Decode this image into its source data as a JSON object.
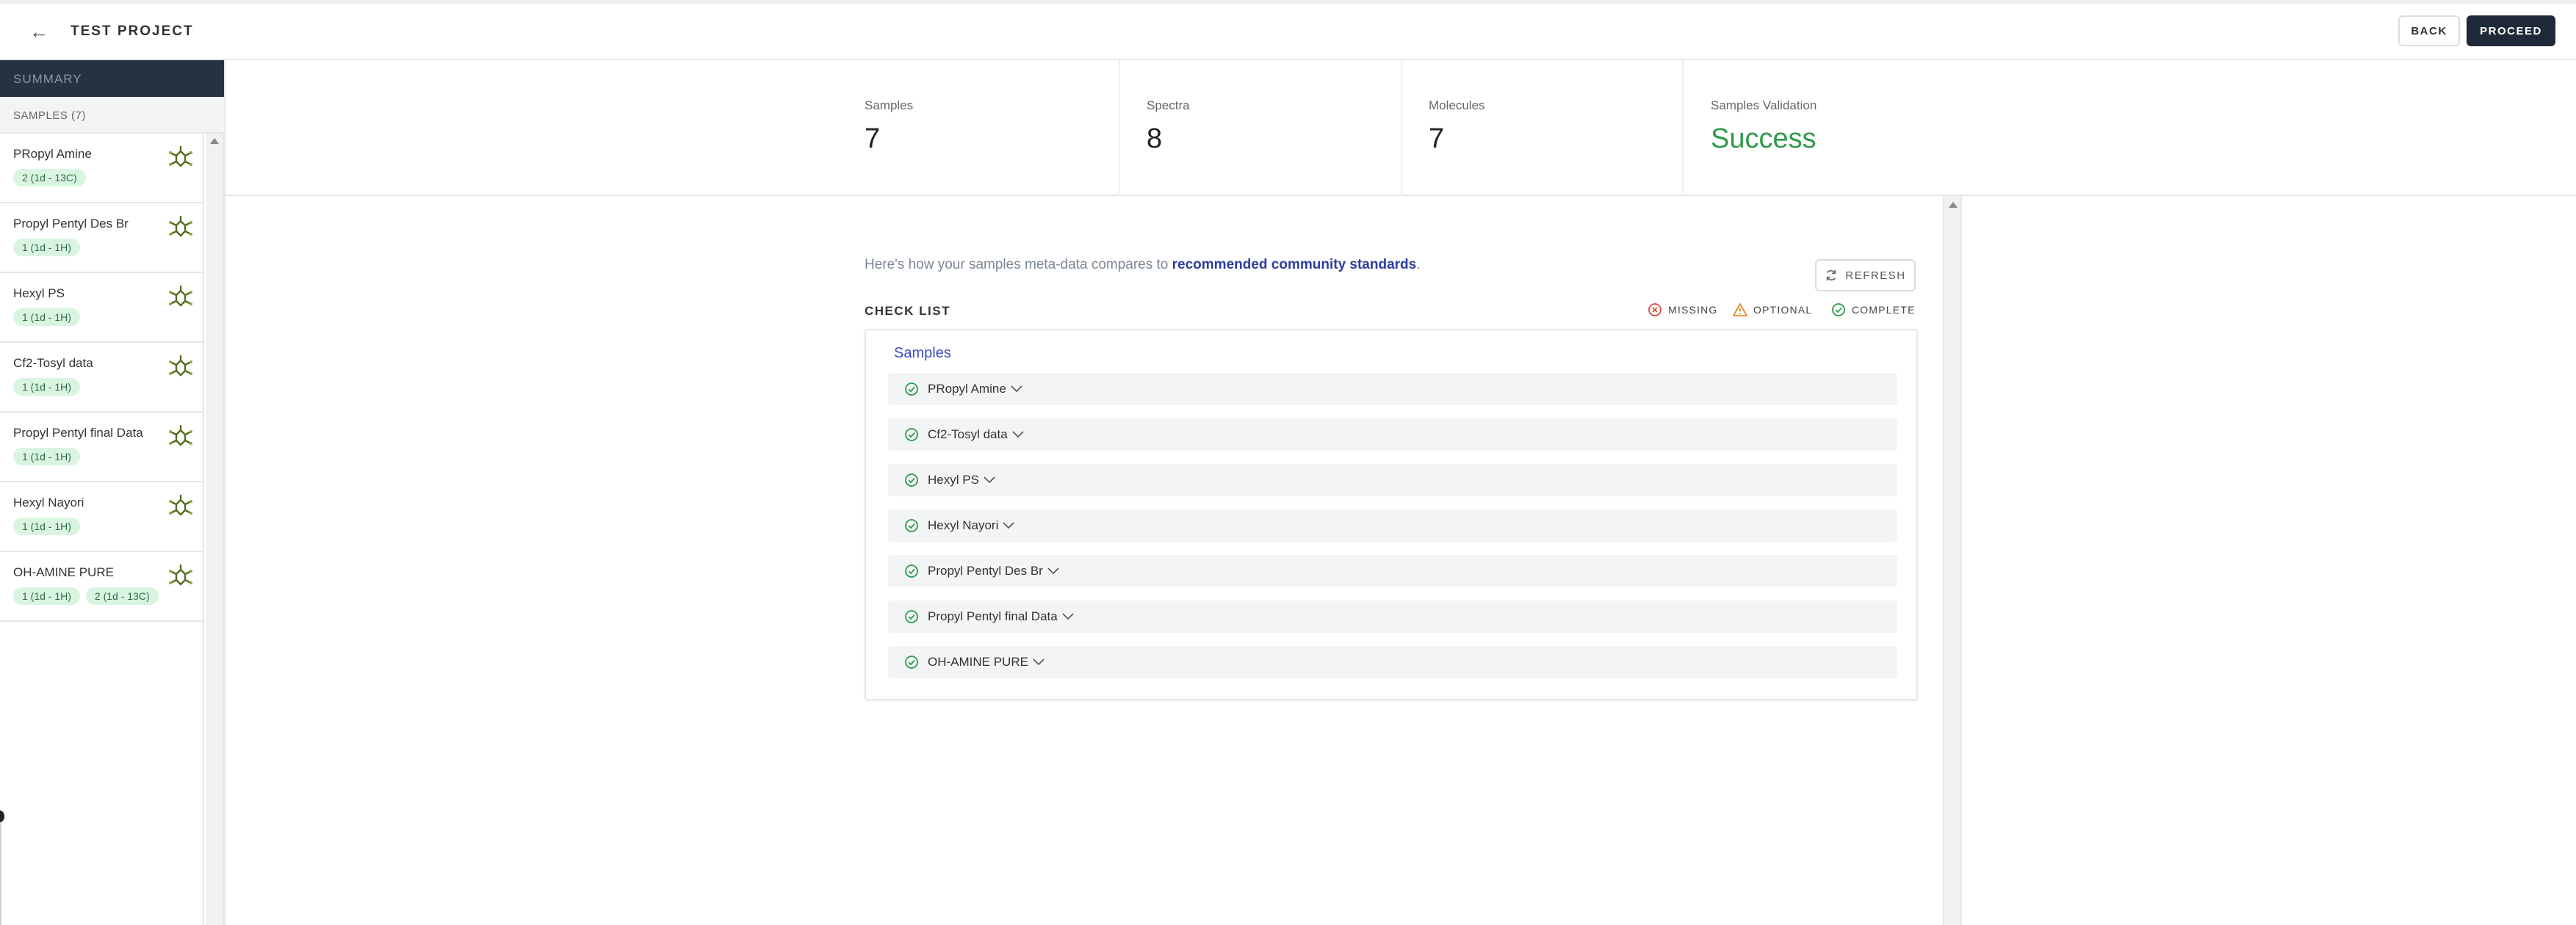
{
  "header": {
    "title": "TEST PROJECT",
    "back_label": "BACK",
    "proceed_label": "PROCEED"
  },
  "sidebar": {
    "summary_label": "SUMMARY",
    "samples_header": "SAMPLES (7)",
    "items": [
      {
        "name": "PRopyl Amine",
        "badges": [
          "2 (1d - 13C)"
        ]
      },
      {
        "name": "Propyl Pentyl Des Br",
        "badges": [
          "1 (1d - 1H)"
        ]
      },
      {
        "name": "Hexyl PS",
        "badges": [
          "1 (1d - 1H)"
        ]
      },
      {
        "name": "Cf2-Tosyl data",
        "badges": [
          "1 (1d - 1H)"
        ]
      },
      {
        "name": "Propyl Pentyl final Data",
        "badges": [
          "1 (1d - 1H)"
        ]
      },
      {
        "name": "Hexyl Nayori",
        "badges": [
          "1 (1d - 1H)"
        ]
      },
      {
        "name": "OH-AMINE PURE",
        "badges": [
          "1 (1d - 1H)",
          "2 (1d - 13C)"
        ]
      }
    ]
  },
  "stats": [
    {
      "label": "Samples",
      "value": "7"
    },
    {
      "label": "Spectra",
      "value": "8"
    },
    {
      "label": "Molecules",
      "value": "7"
    },
    {
      "label": "Samples Validation",
      "value": "Success"
    }
  ],
  "intro": {
    "text": "Here's how your samples meta-data compares to ",
    "link": "recommended community standards",
    "suffix": "."
  },
  "refresh_label": "REFRESH",
  "checklist": {
    "title": "CHECK LIST",
    "legend": {
      "missing": "MISSING",
      "optional": "OPTIONAL",
      "complete": "COMPLETE"
    },
    "panel_title": "Samples",
    "rows": [
      "PRopyl Amine",
      "Cf2-Tosyl data",
      "Hexyl PS",
      "Hexyl Nayori",
      "Propyl Pentyl Des Br",
      "Propyl Pentyl final Data",
      "OH-AMINE PURE"
    ]
  },
  "colors": {
    "success": "#2e9a4a",
    "missing": "#d9483b",
    "optional": "#e08a2c",
    "link": "#2c3e9e",
    "badge_bg": "#d9f5e1",
    "sidebar_dark": "#243241"
  },
  "icons": [
    "back-arrow-icon",
    "molecule-icon",
    "refresh-icon",
    "missing-icon",
    "optional-icon",
    "complete-icon",
    "check-circle-icon",
    "chevron-down-icon"
  ]
}
